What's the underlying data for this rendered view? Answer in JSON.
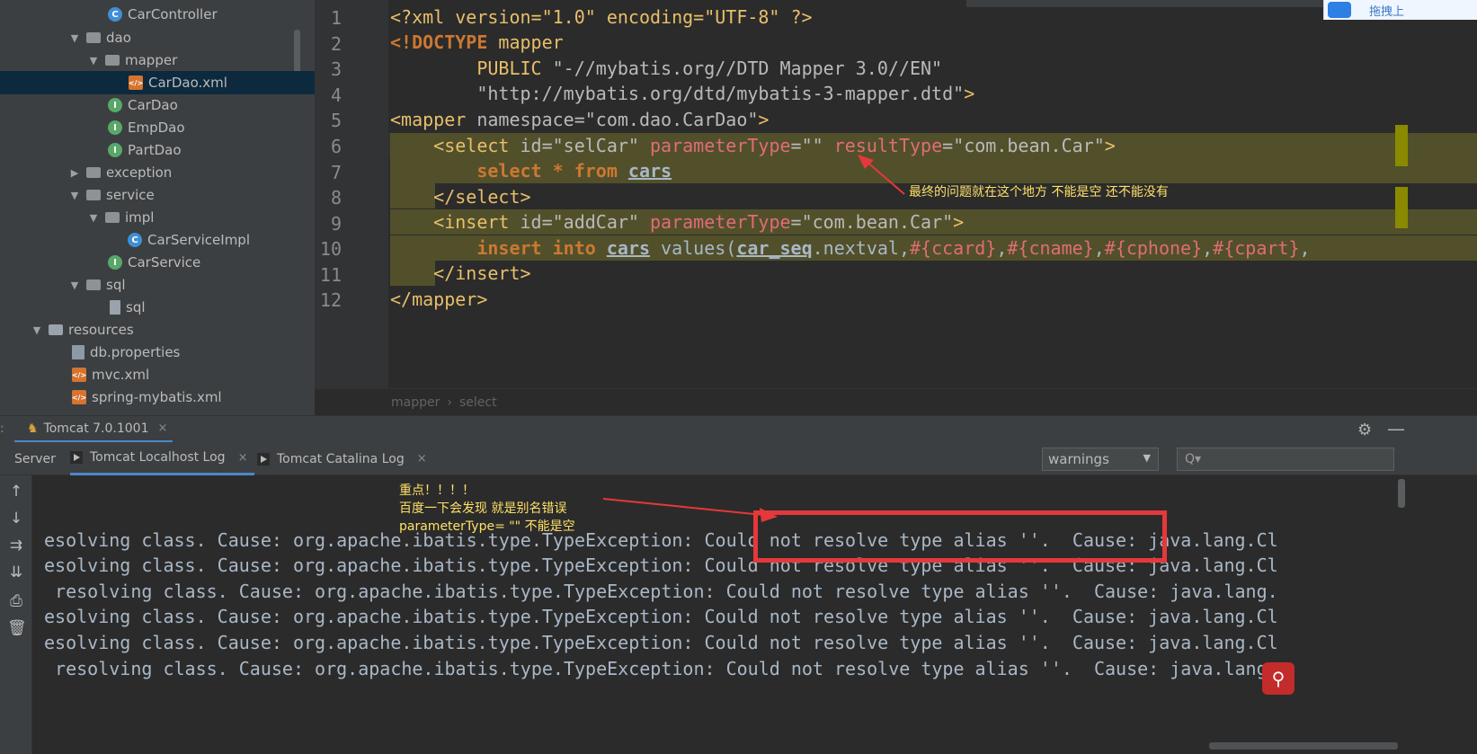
{
  "project_tree": {
    "items": [
      {
        "label": "CarController",
        "icon": "class-icon"
      },
      {
        "label": "dao",
        "icon": "folder-icon"
      },
      {
        "label": "mapper",
        "icon": "folder-icon"
      },
      {
        "label": "CarDao.xml",
        "icon": "xml-file-icon"
      },
      {
        "label": "CarDao",
        "icon": "interface-icon"
      },
      {
        "label": "EmpDao",
        "icon": "interface-icon"
      },
      {
        "label": "PartDao",
        "icon": "interface-icon"
      },
      {
        "label": "exception",
        "icon": "folder-icon"
      },
      {
        "label": "service",
        "icon": "folder-icon"
      },
      {
        "label": "impl",
        "icon": "folder-icon"
      },
      {
        "label": "CarServiceImpl",
        "icon": "class-icon"
      },
      {
        "label": "CarService",
        "icon": "interface-icon"
      },
      {
        "label": "sql",
        "icon": "folder-icon"
      },
      {
        "label": "sql",
        "icon": "file-icon"
      },
      {
        "label": "resources",
        "icon": "resources-folder-icon"
      },
      {
        "label": "db.properties",
        "icon": "properties-file-icon"
      },
      {
        "label": "mvc.xml",
        "icon": "xml-file-icon"
      },
      {
        "label": "spring-mybatis.xml",
        "icon": "xml-file-icon"
      }
    ],
    "selected": "CarDao.xml"
  },
  "editor": {
    "line_numbers": [
      "1",
      "2",
      "3",
      "4",
      "5",
      "6",
      "7",
      "8",
      "9",
      "10",
      "11",
      "12"
    ],
    "lines": {
      "l1": {
        "a": "<?xml version=\"1.0\" encoding=\"UTF-8\" ?>"
      },
      "l2": {
        "a": "<!DOCTYPE",
        "b": " mapper"
      },
      "l3": {
        "a": "        PUBLIC",
        "b": " \"-//mybatis.org//DTD Mapper 3.0//EN\""
      },
      "l4": {
        "a": "        \"http://mybatis.org/dtd/mybatis-3-mapper.dtd\"",
        "b": ">"
      },
      "l5": {
        "a": "<",
        "b": "mapper",
        "c": " namespace",
        "d": "=",
        "e": "\"com.dao.CarDao\"",
        "f": ">"
      },
      "l6": {
        "a": "    <",
        "b": "select",
        "c": " id",
        "d": "=",
        "e": "\"selCar\"",
        "f": " parameterType",
        "g": "=",
        "h": "\"\"",
        "i": " resultType",
        "j": "=",
        "k": "\"com.bean.Car\"",
        "l": ">"
      },
      "l7": {
        "a": "        select * from ",
        "b": "cars"
      },
      "l8": {
        "a": "    </",
        "b": "select",
        "c": ">"
      },
      "l9": {
        "a": "    <",
        "b": "insert",
        "c": " id",
        "d": "=",
        "e": "\"addCar\"",
        "f": " parameterType",
        "g": "=",
        "h": "\"com.bean.Car\"",
        "i": ">"
      },
      "l10": {
        "a": "        insert into ",
        "b": "cars",
        "c": " values(",
        "d": "car_seq",
        "e": ".nextval,",
        "f": "#{ccard}",
        "g": ",",
        "h": "#{cname}",
        "i": ",",
        "j": "#{cphone}",
        "k": ",",
        "l": "#{cpart}",
        "m": ","
      },
      "l11": {
        "a": "    </",
        "b": "insert",
        "c": ">"
      },
      "l12": {
        "a": "</",
        "b": "mapper",
        "c": ">"
      }
    },
    "breadcrumb": [
      "mapper",
      "›",
      "select"
    ],
    "annotation": "最终的问题就在这个地方 不能是空 还不能没有"
  },
  "top_badge": {
    "label": "拖拽上"
  },
  "run_window": {
    "dots": ":",
    "tab_label": "Tomcat 7.0.1001",
    "close": "×",
    "log_tabs": {
      "server": "Server",
      "localhost": "Tomcat Localhost Log",
      "catalina": "Tomcat Catalina Log"
    },
    "filter_value": "warnings",
    "search_placeholder": "Q▾",
    "annotation": "重点！！！！\n百度一下会发现 就是别名错误\nparameterType= \"\" 不能是空",
    "log_lines": [
      "esolving class. Cause: org.apache.ibatis.type.TypeException: Could not resolve type alias ''.  Cause: java.lang.Cl",
      "esolving class. Cause: org.apache.ibatis.type.TypeException: Could not resolve type alias ''.  Cause: java.lang.Cl",
      " resolving class. Cause: org.apache.ibatis.type.TypeException: Could not resolve type alias ''.  Cause: java.lang.",
      "esolving class. Cause: org.apache.ibatis.type.TypeException: Could not resolve type alias ''.  Cause: java.lang.Cl",
      "esolving class. Cause: org.apache.ibatis.type.TypeException: Could not resolve type alias ''.  Cause: java.lang.Cl",
      " resolving class. Cause: org.apache.ibatis.type.TypeException: Could not resolve type alias ''.  Cause: java.lang."
    ]
  },
  "colors": {
    "highlight": "#51502b",
    "annotation_text": "#ffe066",
    "red_box": "#e5383a",
    "accent": "#4a88c7"
  }
}
